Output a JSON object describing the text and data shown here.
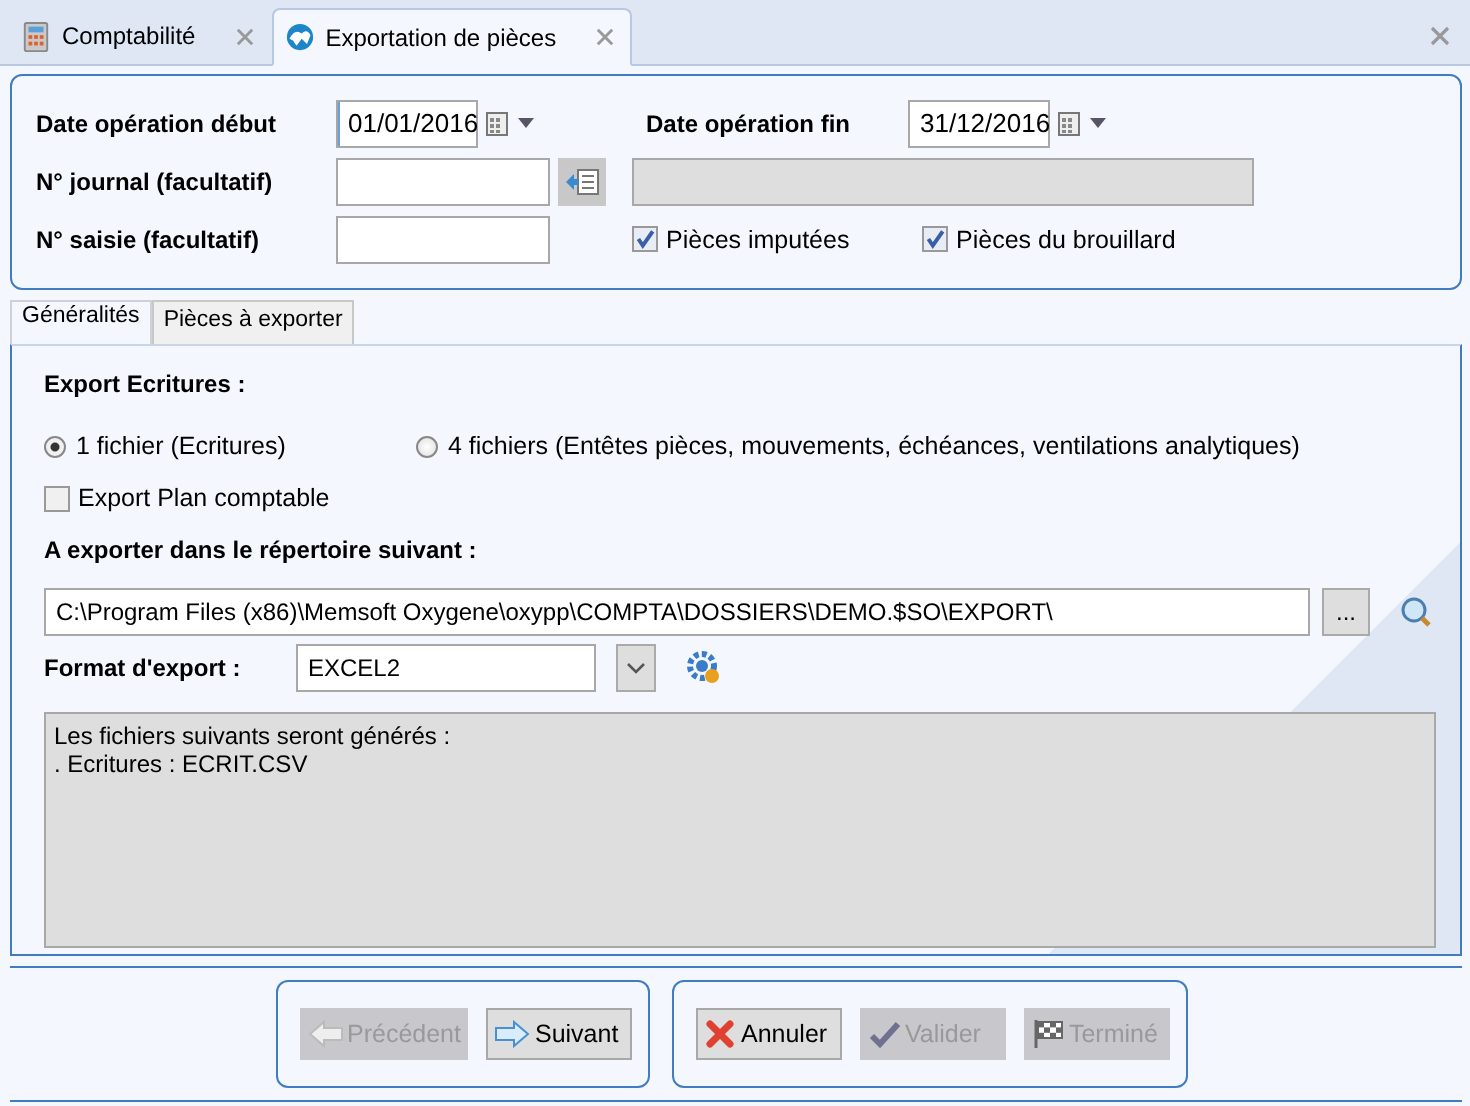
{
  "doc_tabs": [
    {
      "label": "Comptabilité",
      "selected": false,
      "kind": "calculator"
    },
    {
      "label": "Exportation de pièces",
      "selected": true,
      "kind": "export"
    }
  ],
  "criteria": {
    "start_label": "Date opération début",
    "start_value": "01/01/2016",
    "end_label": "Date opération fin",
    "end_value": "31/12/2016",
    "journal_label": "N° journal (facultatif)",
    "entry_label": "N° saisie (facultatif)",
    "checks": [
      {
        "label": "Pièces imputées",
        "checked": true
      },
      {
        "label": "Pièces du brouillard",
        "checked": true
      }
    ]
  },
  "sub_tabs": [
    {
      "label": "Généralités",
      "selected": true
    },
    {
      "label": "Pièces à exporter",
      "selected": false
    }
  ],
  "general": {
    "export_title": "Export Ecritures :",
    "radios": [
      {
        "label": "1 fichier (Ecritures)",
        "selected": true
      },
      {
        "label": "4 fichiers (Entêtes pièces, mouvements, échéances, ventilations analytiques)",
        "selected": false
      }
    ],
    "plan_check": {
      "label": "Export Plan comptable",
      "checked": false
    },
    "dir_label": "A exporter dans le répertoire suivant :",
    "dir_value": "C:\\Program Files (x86)\\Memsoft Oxygene\\oxypp\\COMPTA\\DOSSIERS\\DEMO.$SO\\EXPORT\\",
    "browse": "...",
    "format_label": "Format d'export :",
    "format_value": "EXCEL2",
    "info_lines": [
      "Les fichiers suivants seront générés :",
      ". Ecritures : ECRIT.CSV"
    ]
  },
  "nav_buttons": [
    {
      "label": "Précédent",
      "kind": "back",
      "disabled": true
    },
    {
      "label": "Suivant",
      "kind": "next",
      "disabled": false
    }
  ],
  "action_buttons": [
    {
      "label": "Annuler",
      "kind": "cancel",
      "disabled": false
    },
    {
      "label": "Valider",
      "kind": "validate",
      "disabled": true
    },
    {
      "label": "Terminé",
      "kind": "finish",
      "disabled": true
    }
  ]
}
